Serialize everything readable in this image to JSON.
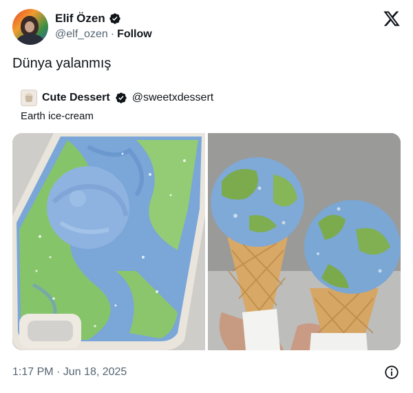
{
  "author": {
    "name": "Elif Özen",
    "handle": "@elf_ozen",
    "separator": "·",
    "follow_label": "Follow"
  },
  "tweet": {
    "text": "Dünya yalanmış",
    "timestamp": "1:17 PM · Jun 18, 2025"
  },
  "quote": {
    "name": "Cute Dessert",
    "handle": "@sweetxdessert",
    "text": "Earth ice-cream"
  },
  "colors": {
    "verified": "#1d9bf0",
    "text": "#0f1419",
    "muted": "#536471"
  },
  "icons": [
    "verified-badge-icon",
    "x-logo-icon",
    "info-icon"
  ]
}
